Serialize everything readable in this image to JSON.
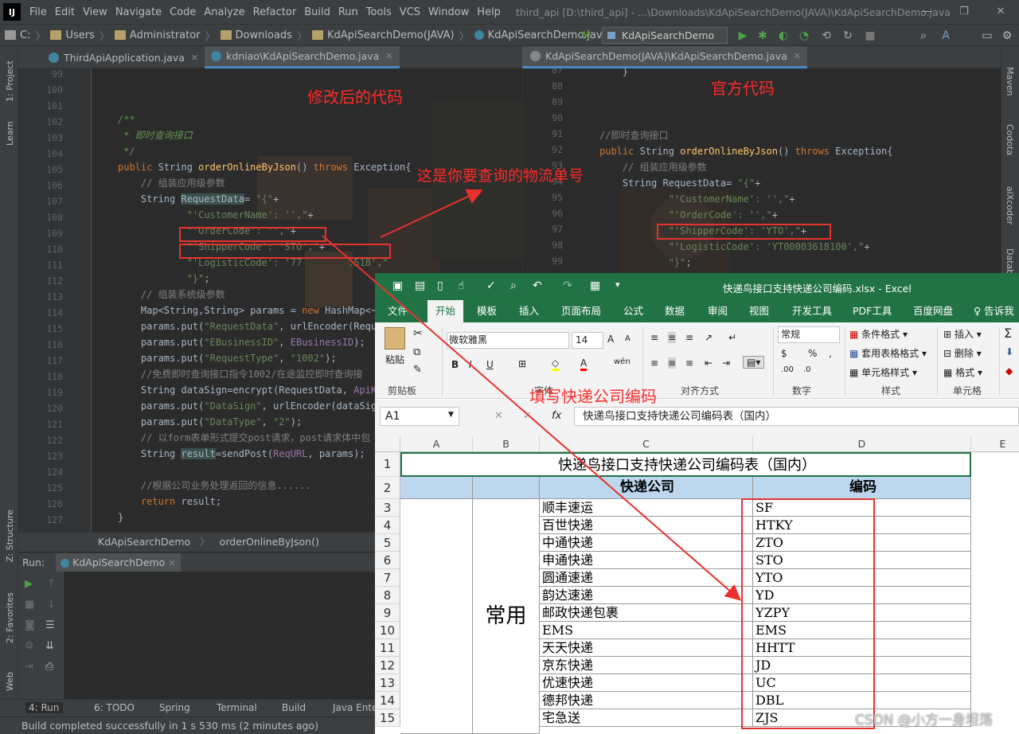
{
  "menubar": {
    "logo": "IJ",
    "items": [
      "File",
      "Edit",
      "View",
      "Navigate",
      "Code",
      "Analyze",
      "Refactor",
      "Build",
      "Run",
      "Tools",
      "VCS",
      "Window",
      "Help"
    ],
    "title": "third_api [D:\\third_api] - ...\\Downloads\\KdApiSearchDemo(JAVA)\\KdApiSearchDemo.java"
  },
  "navbar": {
    "crumbs": [
      "C:",
      "Users",
      "Administrator",
      "Downloads",
      "KdApiSearchDemo(JAVA)",
      "KdApiSearchDemo.java"
    ],
    "run_config": "KdApiSearchDemo"
  },
  "left_strip": {
    "project": "1: Project",
    "learn": "Learn",
    "structure": "Z: Structure",
    "favorites": "2: Favorites",
    "web": "Web"
  },
  "right_strip": {
    "maven": "Maven",
    "codota": "Codota",
    "aixcoder": "aiXcoder",
    "database": "Database"
  },
  "tabs_left": [
    {
      "label": "ThirdApiApplication.java",
      "active": false
    },
    {
      "label": "kdniao\\KdApiSearchDemo.java",
      "active": true
    }
  ],
  "tabs_right": [
    {
      "label": "KdApiSearchDemo(JAVA)\\KdApiSearchDemo.java",
      "active": true
    }
  ],
  "editor_left": {
    "line_numbers": [
      "99",
      "100",
      "101",
      "102",
      "103",
      "104",
      "105",
      "106",
      "107",
      "108",
      "109",
      "110",
      "111",
      "112",
      "113",
      "114",
      "115",
      "116",
      "117",
      "118",
      "119",
      "120",
      "121",
      "122",
      "123",
      "124",
      "125",
      "126",
      "127"
    ]
  },
  "editor_right": {
    "line_numbers": [
      "87",
      "88",
      "89",
      "90",
      "91",
      "92",
      "93",
      "94",
      "95",
      "96",
      "97",
      "98",
      "99"
    ]
  },
  "annotations": {
    "modified": "修改后的代码",
    "official": "官方代码",
    "tracking": "这是你要查询的物流单号",
    "fill_code": "填写快递公司编码"
  },
  "editor_crumb": {
    "class": "KdApiSearchDemo",
    "method": "orderOnlineByJson()"
  },
  "run_panel": {
    "label": "Run:",
    "config": "KdApiSearchDemo"
  },
  "bottom_tools": [
    "4: Run",
    "6: TODO",
    "Spring",
    "Terminal",
    "Build",
    "Java Enter"
  ],
  "status": "Build completed successfully in 1 s 530 ms (2 minutes ago)",
  "watermark": "CSDN @小方一身坦荡",
  "excel": {
    "title": "快递鸟接口支持快递公司编码.xlsx - Excel",
    "tabs": [
      "文件",
      "开始",
      "模板",
      "插入",
      "页面布局",
      "公式",
      "数据",
      "审阅",
      "视图",
      "开发工具",
      "PDF工具",
      "百度网盘",
      "告诉我"
    ],
    "ribbon": {
      "paste": "粘贴",
      "clipboard": "剪贴板",
      "font_name": "微软雅黑",
      "font_size": "14",
      "font_group": "字体",
      "align_group": "对齐方式",
      "number_format": "常规",
      "number_group": "数字",
      "cond_format": "条件格式",
      "table_format": "套用表格格式",
      "cell_style": "单元格样式",
      "styles_group": "样式",
      "insert": "插入",
      "delete": "删除",
      "format": "格式",
      "cells_group": "单元格"
    },
    "name_box": "A1",
    "formula": "快递鸟接口支持快递公司编码表（国内）",
    "columns": [
      "A",
      "B",
      "C",
      "D",
      "E"
    ],
    "sheet_title": "快递鸟接口支持快递公司编码表（国内）",
    "header_company": "快递公司",
    "header_code": "编码",
    "group_label": "常用",
    "rows": [
      {
        "num": "3",
        "company": "顺丰速运",
        "code": "SF"
      },
      {
        "num": "4",
        "company": "百世快递",
        "code": "HTKY"
      },
      {
        "num": "5",
        "company": "中通快递",
        "code": "ZTO"
      },
      {
        "num": "6",
        "company": "申通快递",
        "code": "STO"
      },
      {
        "num": "7",
        "company": "圆通速递",
        "code": "YTO"
      },
      {
        "num": "8",
        "company": "韵达速递",
        "code": "YD"
      },
      {
        "num": "9",
        "company": "邮政快递包裹",
        "code": "YZPY"
      },
      {
        "num": "10",
        "company": "EMS",
        "code": "EMS"
      },
      {
        "num": "11",
        "company": "天天快递",
        "code": "HHTT"
      },
      {
        "num": "12",
        "company": "京东快递",
        "code": "JD"
      },
      {
        "num": "13",
        "company": "优速快递",
        "code": "UC"
      },
      {
        "num": "14",
        "company": "德邦快递",
        "code": "DBL"
      },
      {
        "num": "15",
        "company": "宅急送",
        "code": "ZJS"
      }
    ]
  }
}
